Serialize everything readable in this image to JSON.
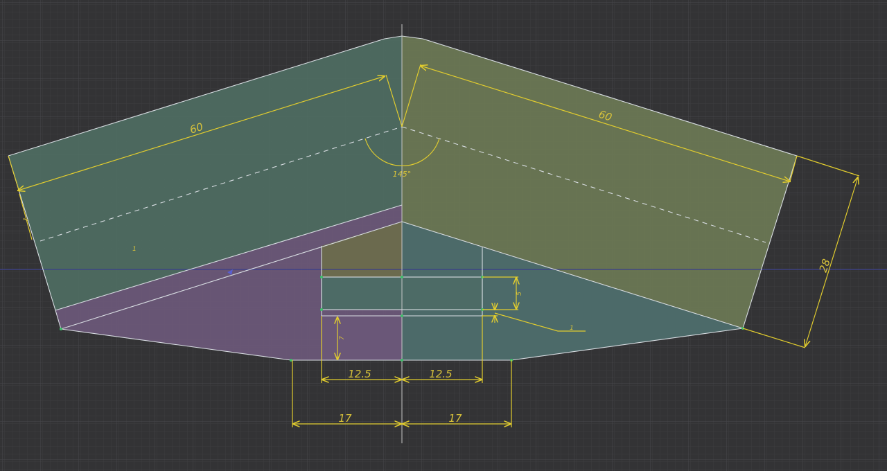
{
  "colors": {
    "background": "#333335",
    "grid_minor": "#3c3c3f",
    "grid_major": "#454549",
    "face_left": "#4f6e63",
    "face_right": "#6d7a55",
    "face_purple": "#6a5778",
    "face_notch": "#6b6a4e",
    "face_teal": "#4c6a69",
    "edge": "#d8dde2",
    "dimension": "#e2cd2e",
    "axis_vertical": "#c8c8c8",
    "axis_horizontal": "#3a3f8c",
    "point": "#3ec06a"
  },
  "dimensions": {
    "left_length": "60",
    "right_length": "60",
    "angle": "145°",
    "width": "28",
    "slot_height": "5",
    "gap_height": "1",
    "lower_height": "7",
    "left_half_slot": "12.5",
    "right_half_slot": "12.5",
    "left_half_base": "17",
    "right_half_base": "17",
    "left_side_mark": "1",
    "center_mark": "1"
  }
}
